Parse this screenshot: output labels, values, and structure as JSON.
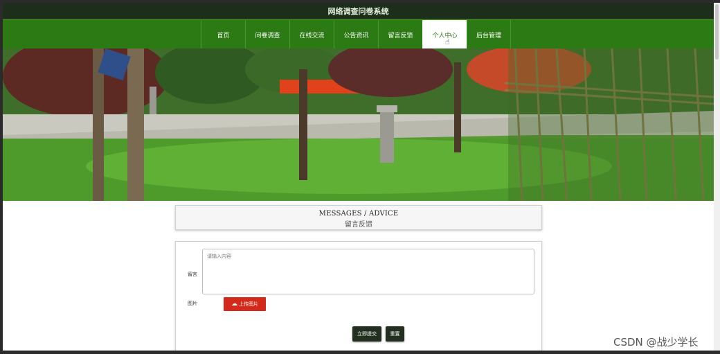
{
  "header": {
    "site_title": "网络调查问卷系统"
  },
  "nav": {
    "items": [
      {
        "label": "首页"
      },
      {
        "label": "问卷调查"
      },
      {
        "label": "在线交流"
      },
      {
        "label": "公告资讯"
      },
      {
        "label": "留言反馈"
      },
      {
        "label": "个人中心",
        "active": true
      },
      {
        "label": "后台管理"
      }
    ]
  },
  "banner": {
    "slide_count": 3,
    "active_slide": 1
  },
  "section": {
    "title_en": "MESSAGES / ADVICE",
    "title_cn": "留言反馈"
  },
  "form": {
    "message_label": "留言",
    "message_placeholder": "请输入内容",
    "image_label": "图片",
    "upload_label": "上传图片",
    "submit_label": "立即提交",
    "reset_label": "重置"
  },
  "watermark": "CSDN @战少学长",
  "colors": {
    "nav_green": "#2c7a13",
    "topbar": "#1d2f1a",
    "upload_red": "#d42a1c",
    "button_dark": "#24301f"
  }
}
